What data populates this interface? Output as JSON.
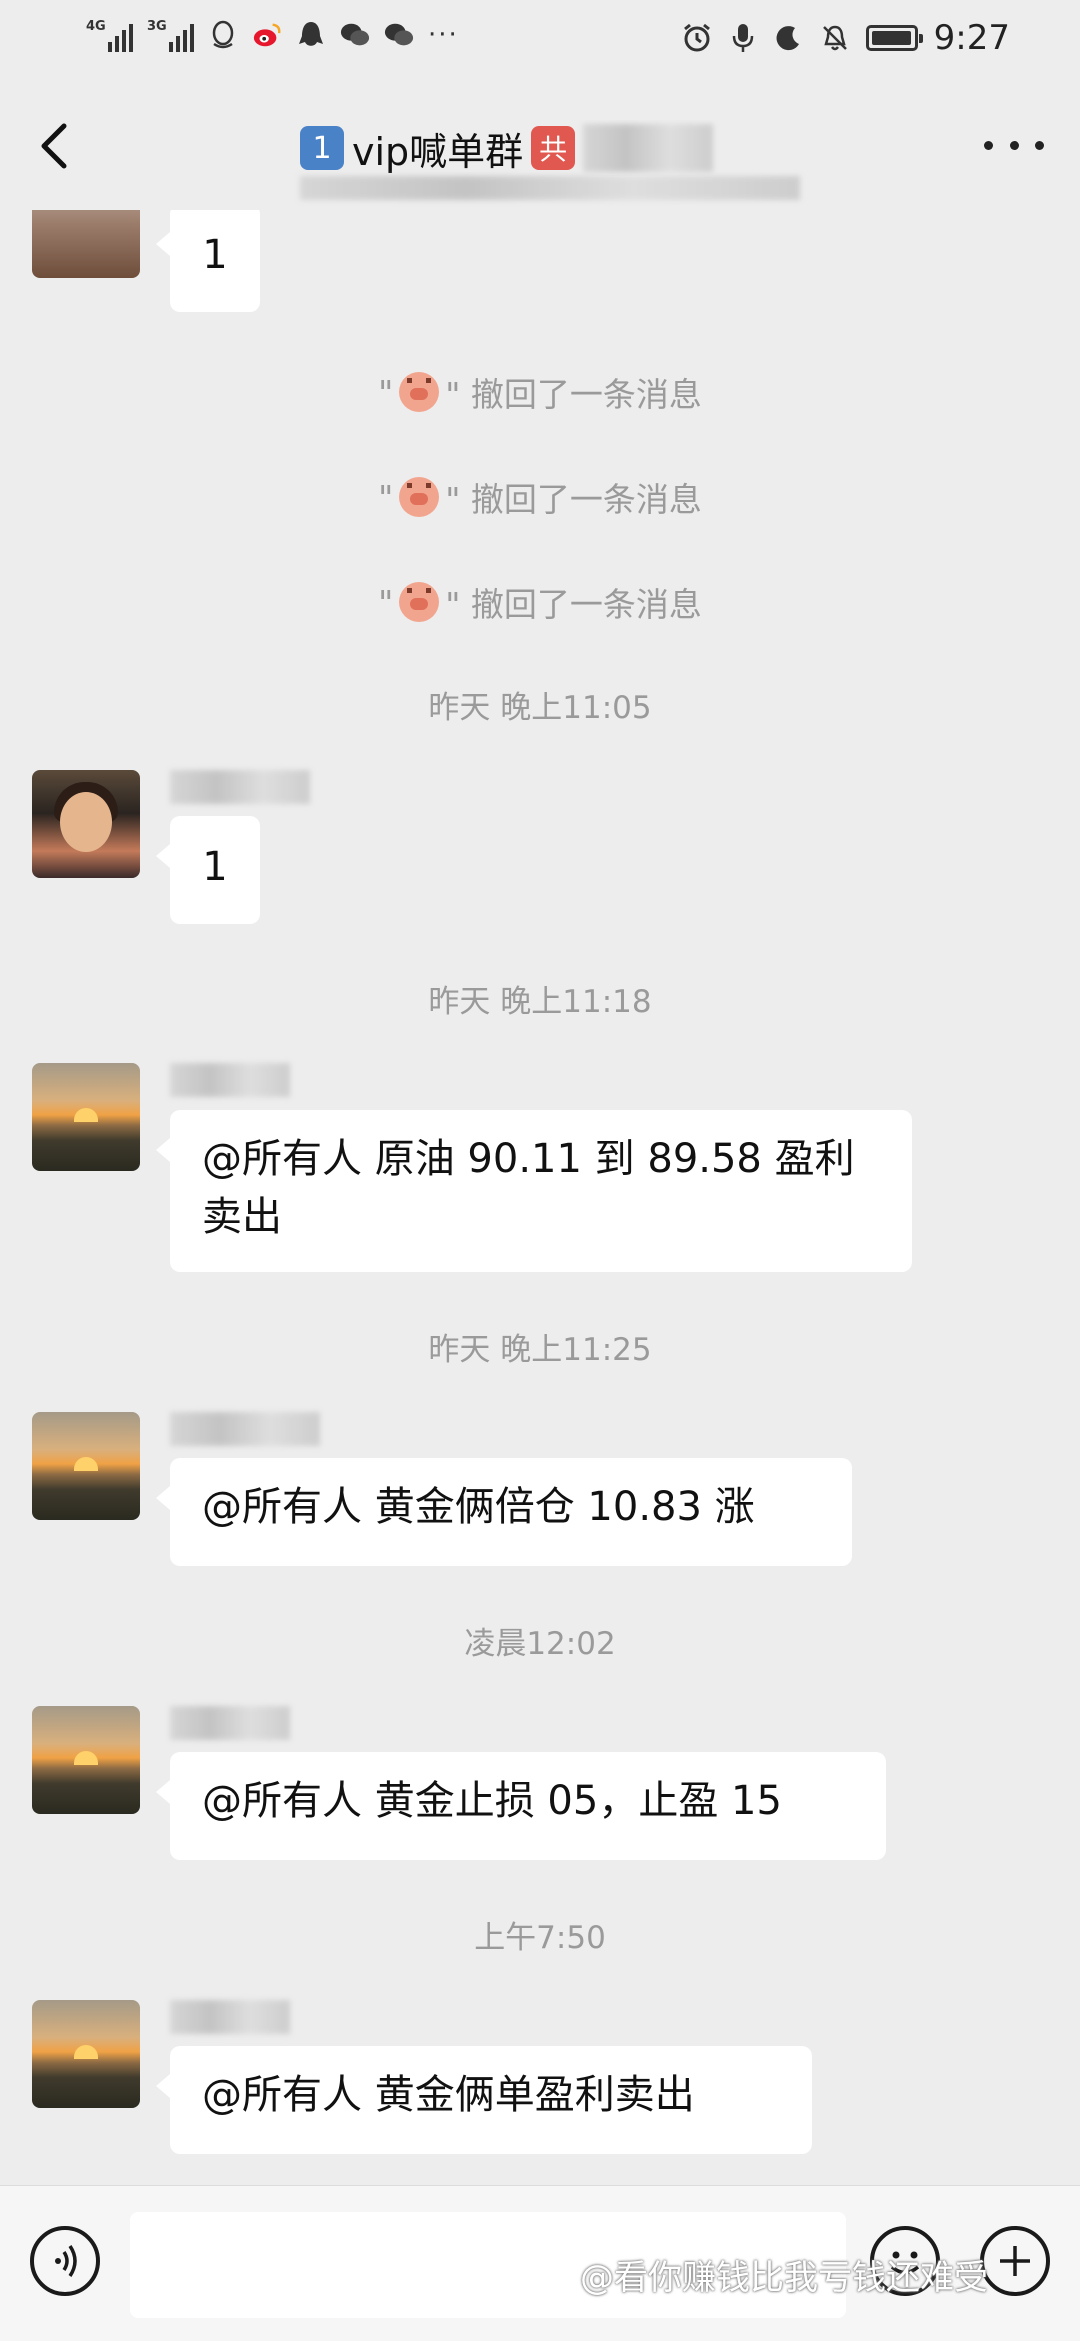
{
  "status_bar": {
    "network_1": "4G",
    "network_2": "3G",
    "time": "9:27",
    "battery_level": 0.85,
    "icons_left": [
      "signal-icon",
      "signal-icon",
      "qq-icon",
      "weibo-icon",
      "qq-penguin-icon",
      "wechat-icon",
      "wechat-icon",
      "more-dots-icon"
    ],
    "icons_right": [
      "alarm-icon",
      "mic-icon",
      "moon-icon",
      "mute-icon",
      "battery-icon"
    ]
  },
  "header": {
    "badge_number": "1",
    "title_visible": "vip喊单群",
    "badge_red": "共"
  },
  "messages": {
    "m1_text": "1",
    "recall_1": "\" \" 撤回了一条消息",
    "recall_2": "\" \" 撤回了一条消息",
    "recall_3": "\" \" 撤回了一条消息",
    "ts1": "昨天 晚上11:05",
    "m2_text": "1",
    "ts2": "昨天 晚上11:18",
    "m3_text": "@所有人  原油 90.11 到 89.58 盈利卖出",
    "ts3": "昨天 晚上11:25",
    "m4_text": "@所有人  黄金俩倍仓 10.83 涨",
    "ts4": "凌晨12:02",
    "m5_text": "@所有人  黄金止损 05，止盈 15",
    "ts5": "上午7:50",
    "m6_text": "@所有人  黄金俩单盈利卖出"
  },
  "footer": {
    "input_value": "",
    "watermark": "@看你赚钱比我亏钱还难受"
  },
  "colors": {
    "background": "#ededed",
    "bubble": "#ffffff",
    "system_text": "#9a9a9a"
  }
}
